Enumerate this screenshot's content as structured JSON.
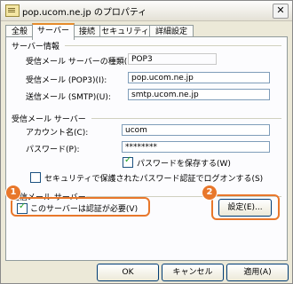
{
  "window": {
    "title": "pop.ucom.ne.jp のプロパティ",
    "close_glyph": "✕"
  },
  "tabs": [
    {
      "label": "全般"
    },
    {
      "label": "サーバー"
    },
    {
      "label": "接続"
    },
    {
      "label": "セキュリティ"
    },
    {
      "label": "詳細設定"
    }
  ],
  "server_info": {
    "group_label": "サーバー情報",
    "server_type_label": "受信メール サーバーの種類(M):",
    "server_type_value": "POP3",
    "incoming_label": "受信メール (POP3)(I):",
    "incoming_value": "pop.ucom.ne.jp",
    "outgoing_label": "送信メール (SMTP)(U):",
    "outgoing_value": "smtp.ucom.ne.jp"
  },
  "incoming_server": {
    "group_label": "受信メール サーバー",
    "account_label": "アカウント名(C):",
    "account_value": "ucom",
    "password_label": "パスワード(P):",
    "password_value": "********",
    "remember_password_label": "パスワードを保存する(W)",
    "spa_label": "セキュリティで保護されたパスワード認証でログオンする(S)"
  },
  "outgoing_server": {
    "group_label": "送信メール サーバー",
    "auth_required_label": "このサーバーは認証が必要(V)",
    "settings_button": "設定(E)..."
  },
  "annotations": {
    "badge1": "1",
    "badge2": "2",
    "color": "#e8772b"
  },
  "footer": {
    "ok": "OK",
    "cancel": "キャンセル",
    "apply": "適用(A)"
  }
}
